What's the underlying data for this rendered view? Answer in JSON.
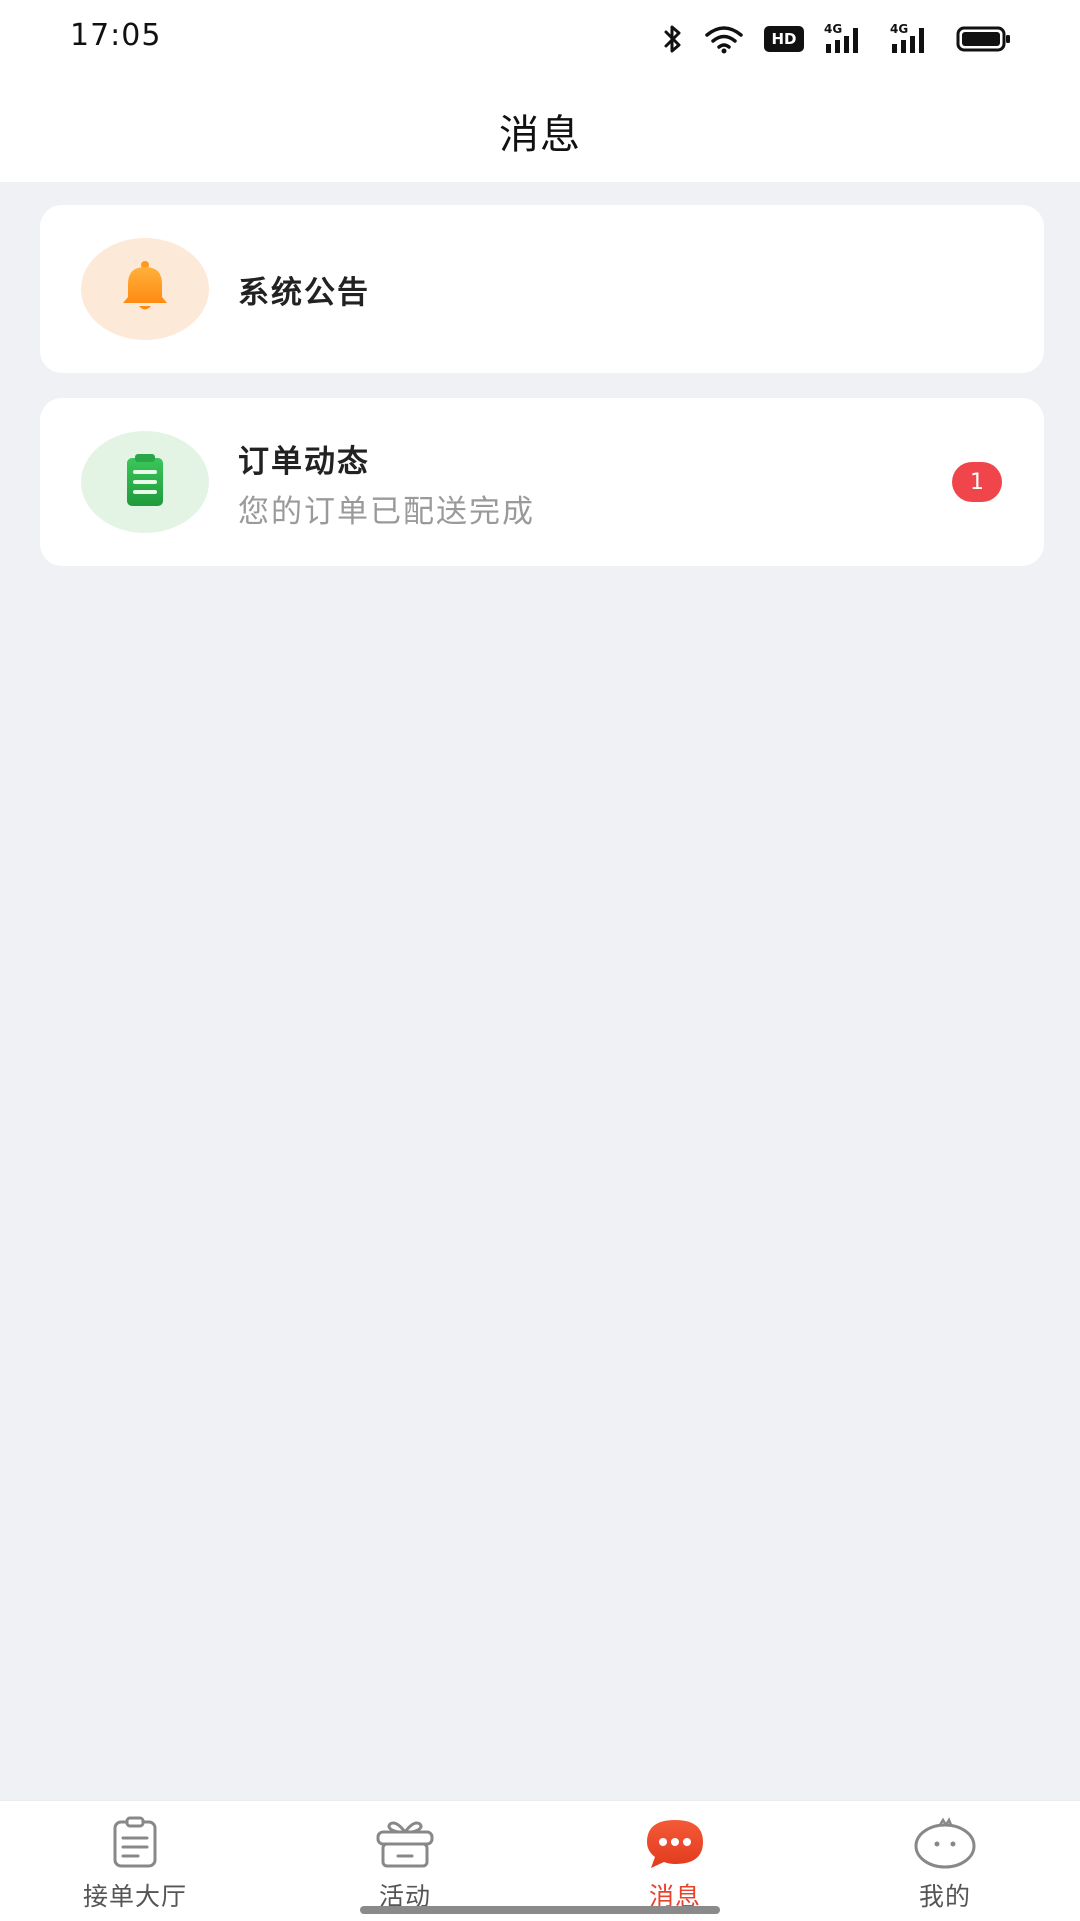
{
  "status_bar": {
    "time": "17:05",
    "icons": [
      "bluetooth-icon",
      "wifi-icon",
      "hd-icon",
      "signal-4g-icon",
      "signal-4g-icon",
      "battery-icon"
    ],
    "hd_label": "HD",
    "network_label_1": "4G",
    "network_label_2": "4G"
  },
  "header": {
    "title": "消息"
  },
  "messages": [
    {
      "title": "系统公告",
      "subtitle": "",
      "icon": "bell-icon",
      "icon_color": "#ff9a1f",
      "icon_bg": "#fde9d8"
    },
    {
      "title": "订单动态",
      "subtitle": "您的订单已配送完成",
      "icon": "clipboard-icon",
      "icon_color": "#25b34a",
      "icon_bg": "#e3f4e5",
      "badge": "1"
    }
  ],
  "bottom_nav": {
    "items": [
      {
        "label": "接单大厅",
        "icon": "order-hall-icon",
        "active": false
      },
      {
        "label": "活动",
        "icon": "gift-icon",
        "active": false
      },
      {
        "label": "消息",
        "icon": "chat-bubble-icon",
        "active": true
      },
      {
        "label": "我的",
        "icon": "profile-face-icon",
        "active": false
      }
    ],
    "active_color": "#e8412c"
  }
}
